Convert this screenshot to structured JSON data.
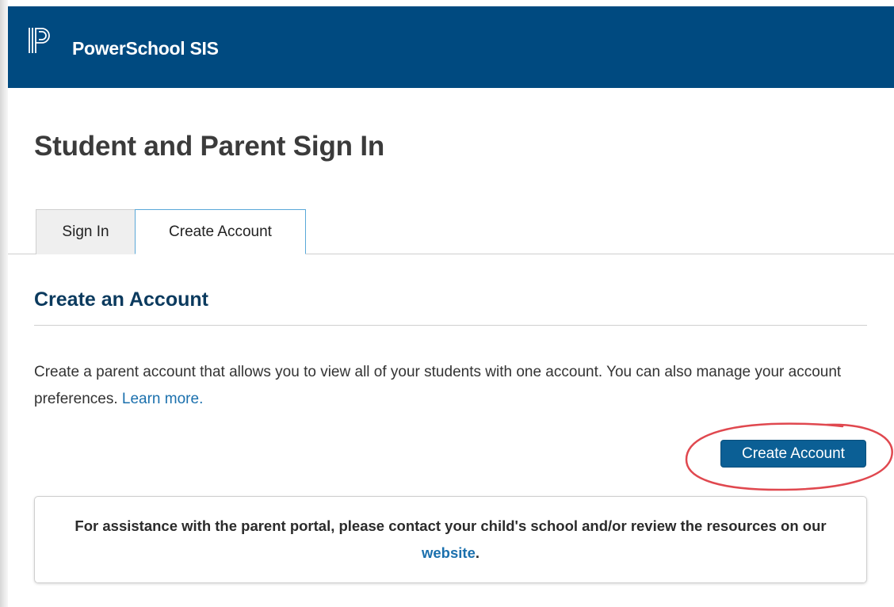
{
  "header": {
    "app_title": "PowerSchool SIS",
    "logo_icon": "powerschool-p-logo",
    "bg_color": "#004a80"
  },
  "page": {
    "title": "Student and Parent Sign In"
  },
  "tabs": [
    {
      "label": "Sign In",
      "active": false
    },
    {
      "label": "Create Account",
      "active": true
    }
  ],
  "create_section": {
    "title": "Create an Account",
    "description": "Create a parent account that allows you to view all of your students with one account. You can also manage your account preferences.",
    "learn_more_link": "Learn more.",
    "button_label": "Create Account",
    "button_color": "#0b5f95",
    "highlight_color": "#e0484f"
  },
  "assistance": {
    "text": "For assistance with the parent portal, please contact your child's school and/or review the resources on our",
    "link": "website",
    "trailing": "."
  }
}
